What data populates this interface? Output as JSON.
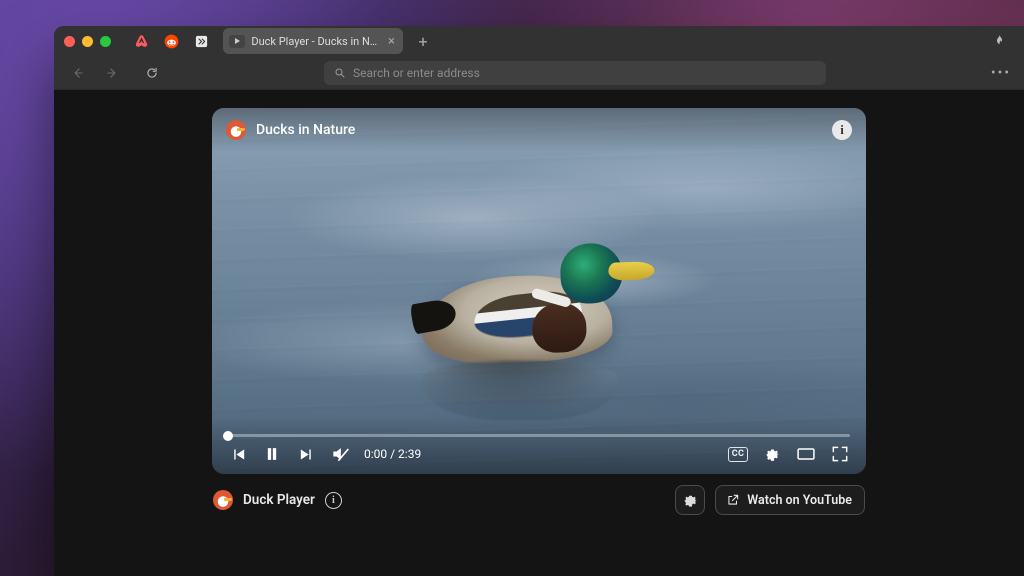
{
  "browser": {
    "tab_title": "Duck Player - Ducks in Nature",
    "address_placeholder": "Search or enter address"
  },
  "player": {
    "video_title": "Ducks in Nature",
    "time": {
      "current": "0:00",
      "duration": "2:39",
      "separator": " / "
    },
    "cc_label": "CC"
  },
  "panel": {
    "app_name": "Duck Player",
    "watch_label": "Watch on YouTube"
  },
  "icons": {
    "info_glyph": "i"
  }
}
